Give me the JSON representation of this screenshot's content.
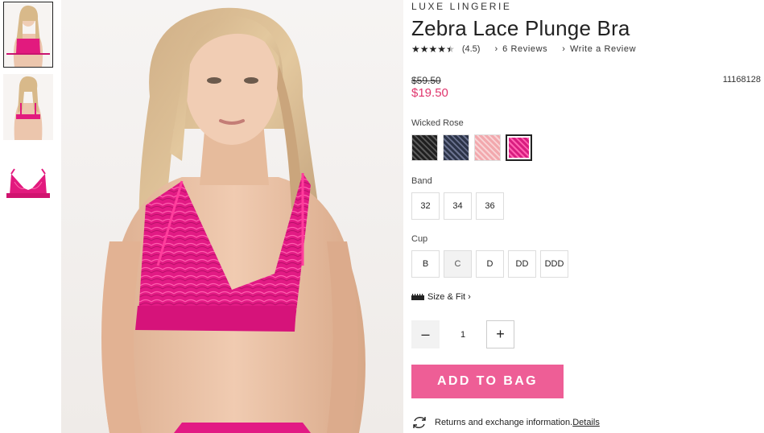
{
  "product": {
    "collection": "LUXE LINGERIE",
    "title": "Zebra Lace Plunge Bra",
    "rating": 4.5,
    "rating_text": "(4.5)",
    "reviews_link": "6 Reviews",
    "write_review_link": "Write a Review",
    "original_price": "$59.50",
    "sale_price": "$19.50",
    "sku": "11168128"
  },
  "color": {
    "selected_name": "Wicked Rose",
    "swatches": [
      {
        "icon": "black-lace-swatch",
        "color": "#2b2b2b"
      },
      {
        "icon": "navy-lace-swatch",
        "color": "#3a4258"
      },
      {
        "icon": "blush-lace-swatch",
        "color": "#f0b5b8"
      },
      {
        "icon": "pink-lace-swatch",
        "color": "#e0358a"
      }
    ]
  },
  "band": {
    "label": "Band",
    "options": [
      "32",
      "34",
      "36"
    ]
  },
  "cup": {
    "label": "Cup",
    "options": [
      "B",
      "C",
      "D",
      "DD",
      "DDD"
    ]
  },
  "size_fit": {
    "label": "Size & Fit",
    "icon": "ruler-icon"
  },
  "quantity": {
    "value": "1",
    "minus_icon": "minus-icon",
    "plus_icon": "plus-icon"
  },
  "add_to_bag": "ADD TO BAG",
  "returns": {
    "text": "Returns and exchange information.",
    "link": "Details",
    "icon": "exchange-icon"
  },
  "colors": {
    "accent_pink": "#ee5e96",
    "sale_price": "#e0356d"
  }
}
